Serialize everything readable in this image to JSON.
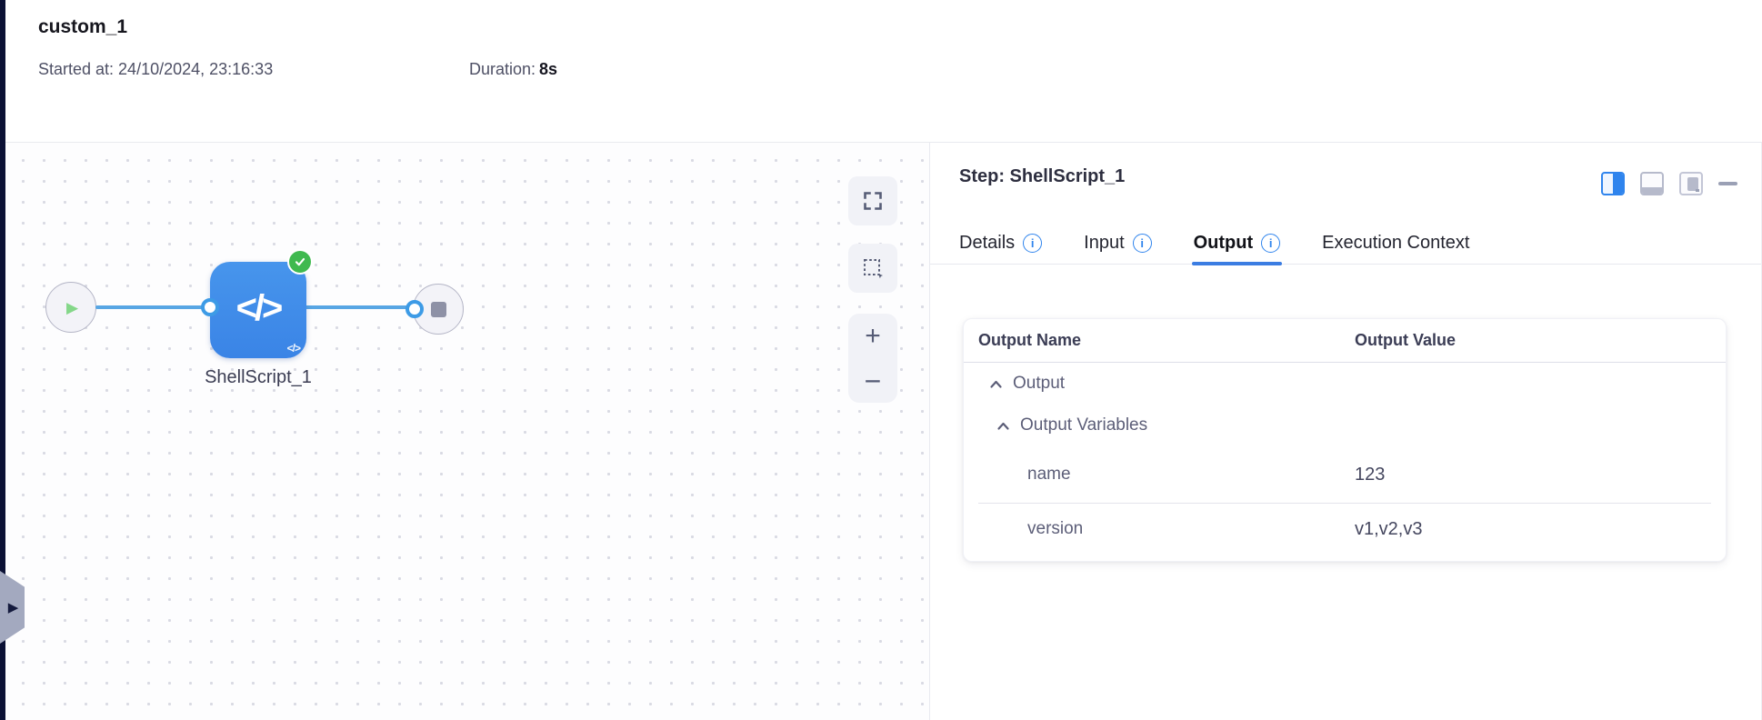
{
  "header": {
    "title": "custom_1",
    "started_label": "Started at: 24/10/2024, 23:16:33",
    "duration_label": "Duration:",
    "duration_value": "8s"
  },
  "canvas": {
    "node_label": "ShellScript_1",
    "glyphs": {
      "code": "</>",
      "code_small": "</>",
      "play": "▶",
      "zoom_in": "+",
      "zoom_out": "−"
    }
  },
  "panel": {
    "title": "Step: ShellScript_1",
    "info_glyph": "i",
    "tabs": [
      {
        "label": "Details"
      },
      {
        "label": "Input"
      },
      {
        "label": "Output"
      },
      {
        "label": "Execution Context"
      }
    ],
    "active_tab": "Output",
    "table": {
      "col_name": "Output Name",
      "col_value": "Output Value",
      "group1": "Output",
      "group2": "Output Variables",
      "rows": [
        {
          "name": "name",
          "value": "123"
        },
        {
          "name": "version",
          "value": "v1,v2,v3"
        }
      ]
    }
  },
  "colors": {
    "accent_blue": "#2f84ed",
    "node_blue": "#3f8ce9",
    "connector_blue": "#58a6e4",
    "success_green": "#3fb94f",
    "tab_underline": "#3b7de2",
    "rail_dark": "#0b1135"
  }
}
